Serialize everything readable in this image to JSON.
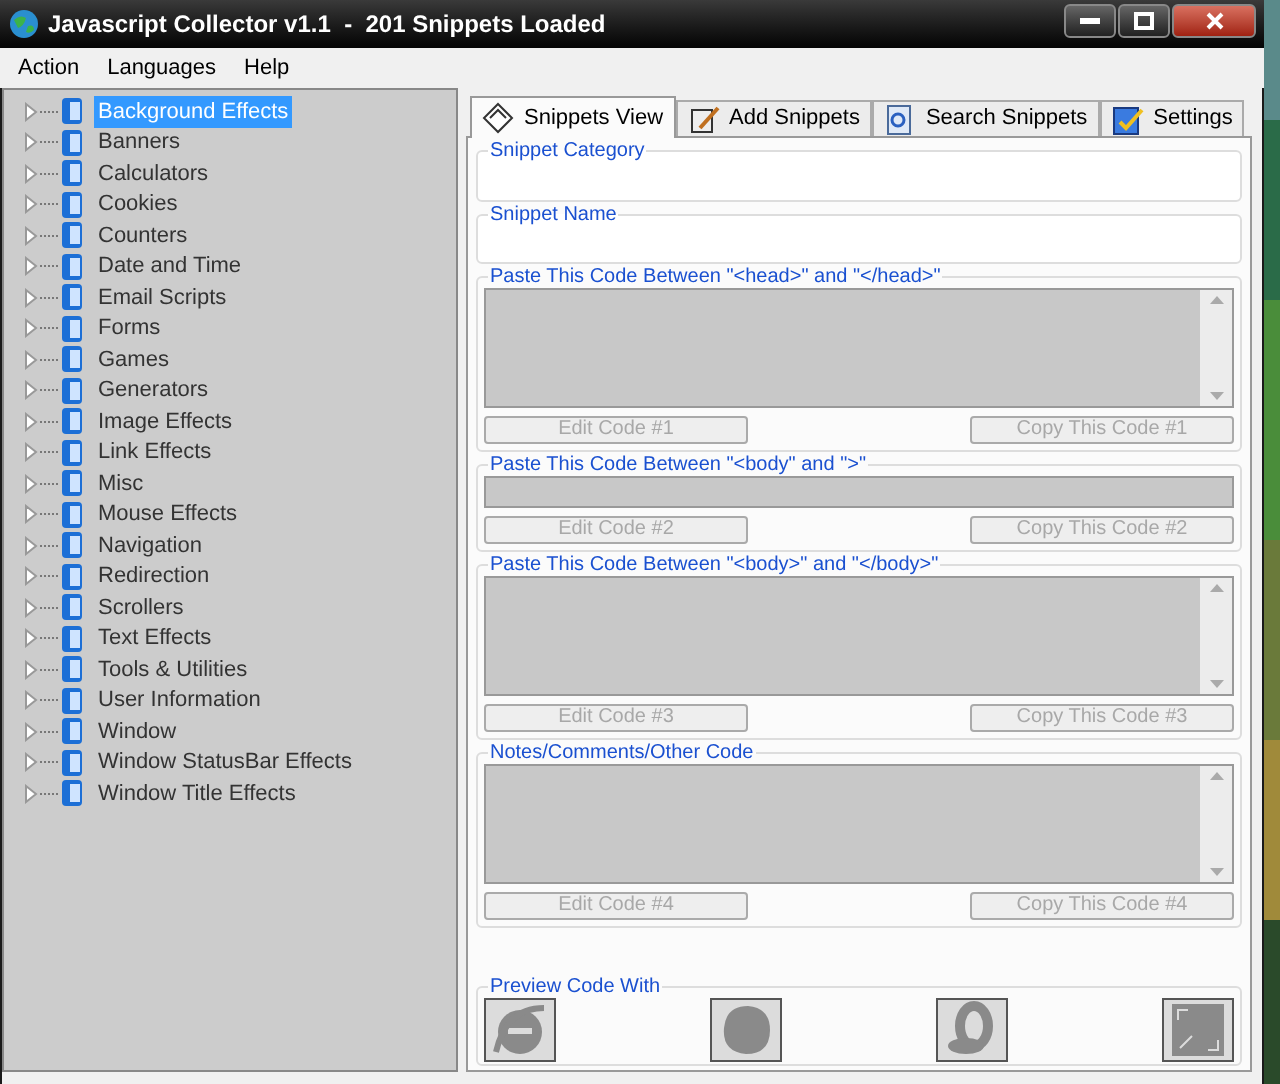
{
  "window": {
    "title": "Javascript Collector v1.1  -  201 Snippets Loaded"
  },
  "menu": [
    "Action",
    "Languages",
    "Help"
  ],
  "tree": {
    "items": [
      {
        "label": "Background Effects",
        "selected": true
      },
      {
        "label": "Banners",
        "selected": false
      },
      {
        "label": "Calculators",
        "selected": false
      },
      {
        "label": "Cookies",
        "selected": false
      },
      {
        "label": "Counters",
        "selected": false
      },
      {
        "label": "Date and Time",
        "selected": false
      },
      {
        "label": "Email Scripts",
        "selected": false
      },
      {
        "label": "Forms",
        "selected": false
      },
      {
        "label": "Games",
        "selected": false
      },
      {
        "label": "Generators",
        "selected": false
      },
      {
        "label": "Image Effects",
        "selected": false
      },
      {
        "label": "Link Effects",
        "selected": false
      },
      {
        "label": "Misc",
        "selected": false
      },
      {
        "label": "Mouse Effects",
        "selected": false
      },
      {
        "label": "Navigation",
        "selected": false
      },
      {
        "label": "Redirection",
        "selected": false
      },
      {
        "label": "Scrollers",
        "selected": false
      },
      {
        "label": "Text Effects",
        "selected": false
      },
      {
        "label": "Tools & Utilities",
        "selected": false
      },
      {
        "label": "User Information",
        "selected": false
      },
      {
        "label": "Window",
        "selected": false
      },
      {
        "label": "Window StatusBar Effects",
        "selected": false
      },
      {
        "label": "Window Title Effects",
        "selected": false
      }
    ]
  },
  "tabs": [
    {
      "label": "Snippets View",
      "selected": true,
      "kind": "view"
    },
    {
      "label": "Add Snippets",
      "selected": false,
      "kind": "add"
    },
    {
      "label": "Search Snippets",
      "selected": false,
      "kind": "search"
    },
    {
      "label": "Settings",
      "selected": false,
      "kind": "settings"
    }
  ],
  "sections": [
    {
      "kind": "field",
      "label": "Snippet Category"
    },
    {
      "kind": "field",
      "label": "Snippet Name"
    },
    {
      "kind": "code",
      "label": "Paste This Code Between \"<head>\" and \"</head>\"",
      "buttons": [
        {
          "label": "Edit Code #1",
          "disabled": true
        },
        {
          "label": "Copy This Code #1",
          "disabled": true
        }
      ]
    },
    {
      "kind": "line",
      "label": "Paste This Code Between \"<body\" and \">\"",
      "buttons": [
        {
          "label": "Edit Code #2",
          "disabled": true
        },
        {
          "label": "Copy This Code #2",
          "disabled": true
        }
      ]
    },
    {
      "kind": "code",
      "label": "Paste This Code Between \"<body>\" and \"</body>\"",
      "buttons": [
        {
          "label": "Edit Code #3",
          "disabled": true
        },
        {
          "label": "Copy This Code #3",
          "disabled": true
        }
      ]
    },
    {
      "kind": "code",
      "label": "Notes/Comments/Other Code",
      "buttons": [
        {
          "label": "Edit Code #4",
          "disabled": true
        },
        {
          "label": "Copy This Code #4",
          "disabled": true
        }
      ]
    }
  ],
  "preview": {
    "label": "Preview Code With",
    "browsers": [
      {
        "kind": "ie",
        "disabled": true
      },
      {
        "kind": "firefox",
        "disabled": true
      },
      {
        "kind": "opera",
        "disabled": true
      },
      {
        "kind": "other",
        "disabled": true
      }
    ]
  }
}
